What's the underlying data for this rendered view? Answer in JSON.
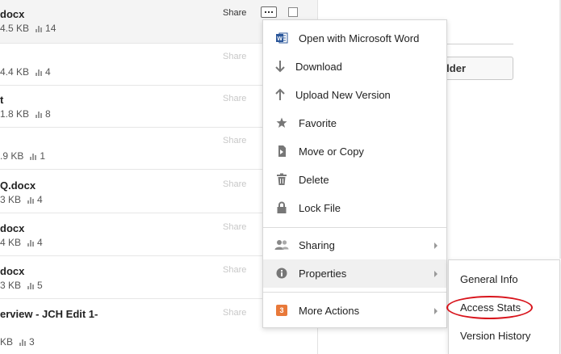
{
  "files": [
    {
      "name": "docx",
      "size": "4.5 KB",
      "views": "14",
      "share": "Share",
      "selected": true
    },
    {
      "name": "",
      "size": "4.4 KB",
      "views": "4",
      "share": "Share"
    },
    {
      "name": "t",
      "size": "1.8 KB",
      "views": "8",
      "share": "Share"
    },
    {
      "name": "",
      "size": ".9 KB",
      "views": "1",
      "share": "Share"
    },
    {
      "name": "Q.docx",
      "size": "3 KB",
      "views": "4",
      "share": "Share"
    },
    {
      "name": "docx",
      "size": "4 KB",
      "views": "4",
      "share": "Share"
    },
    {
      "name": "docx",
      "size": "3 KB",
      "views": "5",
      "share": "Share"
    },
    {
      "name": "erview - JCH Edit 1-",
      "size": "KB",
      "views": "3",
      "share": "Share"
    }
  ],
  "right_panel": {
    "folder_button_label": "lder"
  },
  "menu": {
    "items": [
      {
        "label": "Open with Microsoft Word",
        "icon": "word-icon"
      },
      {
        "label": "Download",
        "icon": "download-arrow-icon"
      },
      {
        "label": "Upload New Version",
        "icon": "upload-arrow-icon"
      },
      {
        "label": "Favorite",
        "icon": "star-icon"
      },
      {
        "label": "Move or Copy",
        "icon": "move-copy-icon"
      },
      {
        "label": "Delete",
        "icon": "trash-icon"
      },
      {
        "label": "Lock File",
        "icon": "lock-icon"
      },
      {
        "label": "Sharing",
        "icon": "people-icon"
      },
      {
        "label": "Properties",
        "icon": "info-icon"
      },
      {
        "label": "More Actions",
        "icon": "badge-3-icon",
        "badge": "3"
      }
    ]
  },
  "submenu": {
    "items": [
      "General Info",
      "Access Stats",
      "Version History"
    ]
  },
  "colors": {
    "highlight_ring": "#d8131b",
    "badge": "#e8793a",
    "word_blue": "#2b579a"
  }
}
